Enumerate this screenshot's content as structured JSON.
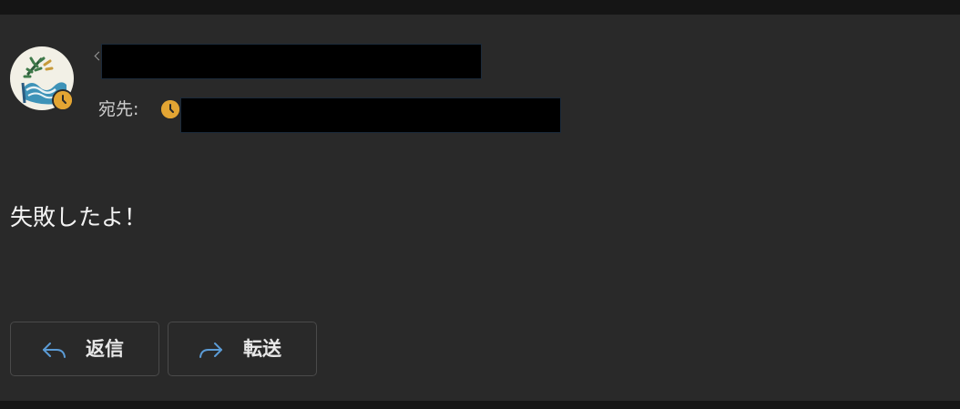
{
  "message": {
    "recipient_label": "宛先:",
    "body": "失敗したよ！"
  },
  "actions": {
    "reply_label": "返信",
    "forward_label": "転送"
  },
  "icons": {
    "avatar": "wave-plant-logo-icon",
    "presence": "clock-away-icon",
    "reply": "reply-arrow-icon",
    "forward": "forward-arrow-icon",
    "expand": "chevron-left-icon"
  },
  "colors": {
    "background": "#292929",
    "presence_away": "#e3a533",
    "accent_icon": "#5b9bd5",
    "text": "#f3f3f3"
  }
}
